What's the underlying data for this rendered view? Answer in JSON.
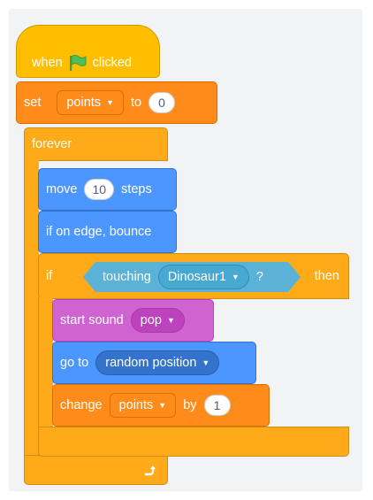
{
  "hat": {
    "when": "when",
    "clicked": "clicked",
    "flag_icon": "green-flag-icon"
  },
  "set_block": {
    "set": "set",
    "variable": "points",
    "to": "to",
    "value": "0"
  },
  "forever": {
    "label": "forever",
    "loop_icon": "loop-arrow-icon"
  },
  "move": {
    "label": "move",
    "value": "10",
    "unit": "steps"
  },
  "bounce": {
    "label": "if on edge, bounce"
  },
  "if_block": {
    "if": "if",
    "then": "then",
    "touching": "touching",
    "target": "Dinosaur1",
    "q": "?"
  },
  "sound": {
    "label": "start sound",
    "value": "pop"
  },
  "goto": {
    "label": "go to",
    "value": "random position"
  },
  "change": {
    "label": "change",
    "variable": "points",
    "by": "by",
    "value": "1"
  },
  "colors": {
    "events": "#ffbf00",
    "control": "#ffab19",
    "variables": "#ff8c1a",
    "motion": "#4c97ff",
    "sound": "#cf63cf",
    "sensing": "#5cb1d6"
  }
}
